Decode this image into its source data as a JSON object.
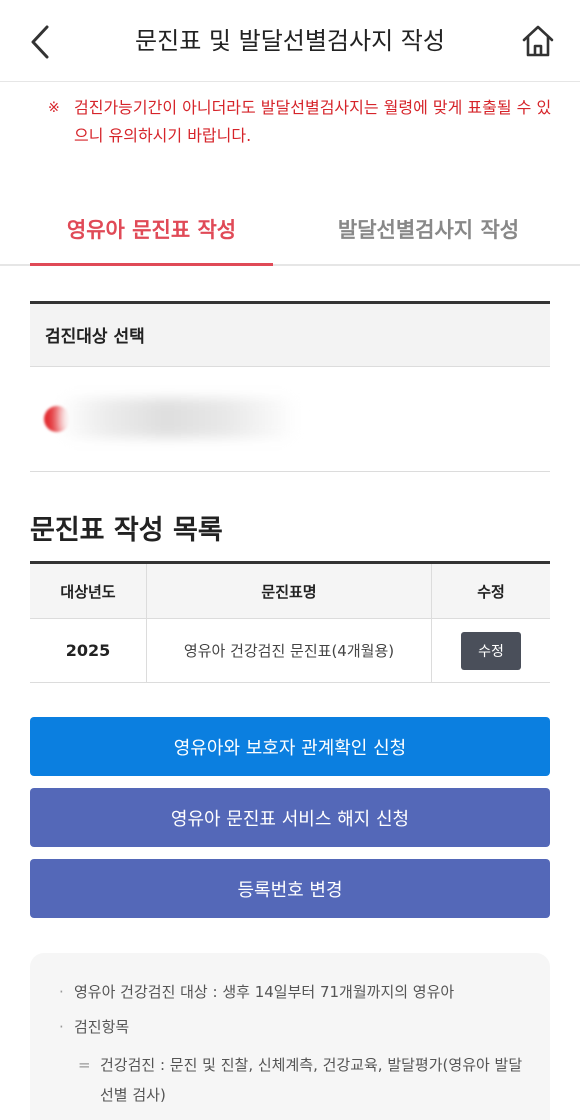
{
  "header": {
    "title": "문진표 및 발달선별검사지 작성"
  },
  "notice": {
    "mark": "※",
    "text": "검진가능기간이 아니더라도 발달선별검사지는 월령에 맞게 표출될 수 있으니 유의하시기 바랍니다."
  },
  "tabs": [
    {
      "label": "영유아 문진표 작성"
    },
    {
      "label": "발달선별검사지 작성"
    }
  ],
  "target": {
    "title": "검진대상 선택"
  },
  "list": {
    "title": "문진표 작성 목록",
    "headers": [
      "대상년도",
      "문진표명",
      "수정"
    ],
    "rows": [
      {
        "year": "2025",
        "name": "영유아 건강검진 문진표(4개월용)",
        "edit_label": "수정"
      }
    ]
  },
  "buttons": {
    "relationship": "영유아와 보호자 관계확인 신청",
    "cancel_service": "영유아 문진표 서비스 해지 신청",
    "change_reg": "등록번호 변경"
  },
  "info": {
    "item1": "영유아 건강검진 대상 : 생후 14일부터 71개월까지의 영유아",
    "item2": "검진항목",
    "sub1": "건강검진 : 문진 및 진찰, 신체계측, 건강교육, 발달평가(영유아 발달선별 검사)"
  },
  "colors": {
    "accent_red": "#e04a57",
    "notice_red": "#d6242a",
    "primary_blue": "#0b7fe0",
    "secondary_indigo": "#5468b8"
  },
  "icons": {
    "back": "chevron-left-icon",
    "home": "home-icon"
  }
}
